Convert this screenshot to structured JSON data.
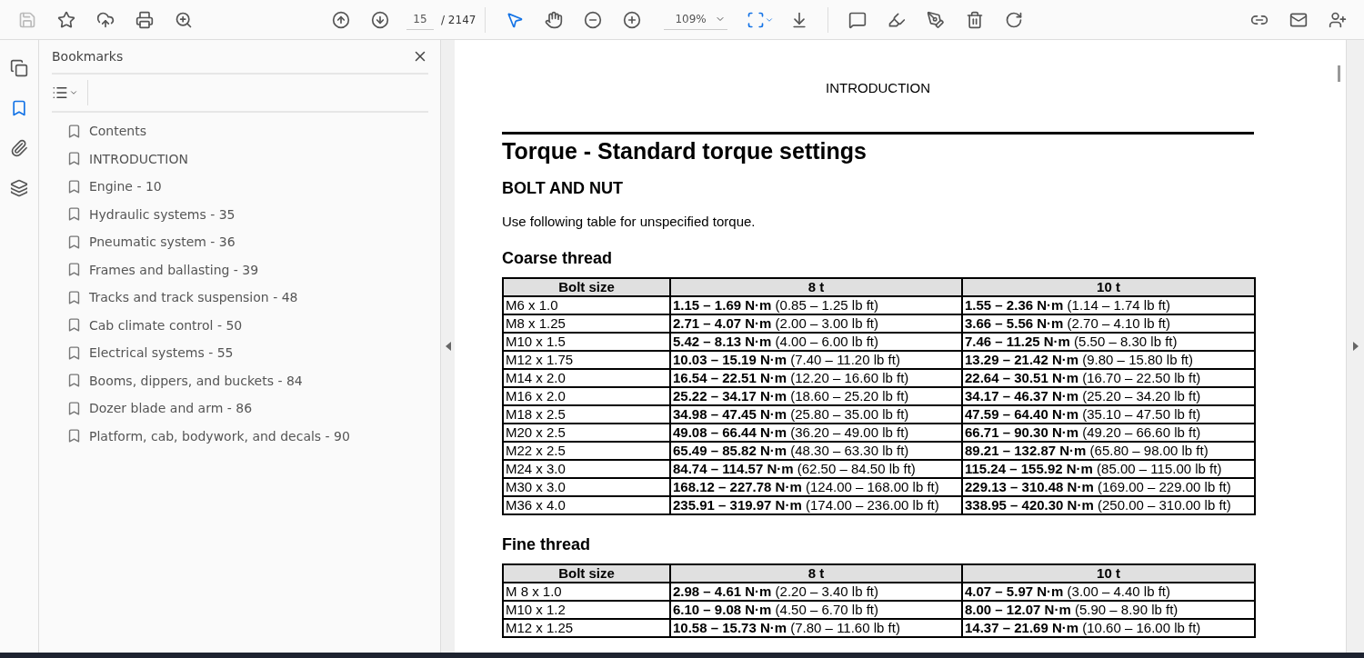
{
  "toolbar": {
    "save_disabled": true,
    "page_number": "15",
    "page_total": "/ 2147",
    "zoom": "109%",
    "tools": [
      {
        "selected": true
      },
      {
        "selected": false
      }
    ]
  },
  "rail": [
    {
      "selected": false
    },
    {
      "selected": true
    },
    {
      "selected": false
    },
    {
      "selected": false
    }
  ],
  "bookmarks": {
    "title": "Bookmarks",
    "items": [
      {
        "label": "Contents"
      },
      {
        "label": "INTRODUCTION"
      },
      {
        "label": "Engine - 10"
      },
      {
        "label": "Hydraulic systems - 35"
      },
      {
        "label": "Pneumatic system - 36"
      },
      {
        "label": "Frames and ballasting - 39"
      },
      {
        "label": "Tracks and track suspension - 48"
      },
      {
        "label": "Cab climate control - 50"
      },
      {
        "label": "Electrical systems - 55"
      },
      {
        "label": "Booms, dippers, and buckets - 84"
      },
      {
        "label": "Dozer blade and arm - 86"
      },
      {
        "label": "Platform, cab, bodywork, and decals - 90"
      }
    ]
  },
  "document": {
    "running_header": "INTRODUCTION",
    "title": "Torque - Standard torque settings",
    "subtitle": "BOLT AND NUT",
    "intro": "Use following table for unspecified torque.",
    "sections": [
      {
        "heading": "Coarse thread",
        "columns": [
          "Bolt size",
          "8 t",
          "10 t"
        ],
        "rows": [
          [
            "M6 x 1.0",
            "**1.15 – 1.69 N·m** (0.85 – 1.25 lb ft)",
            "**1.55 – 2.36 N·m** (1.14 – 1.74 lb ft)"
          ],
          [
            "M8 x 1.25",
            "**2.71 – 4.07 N·m** (2.00 – 3.00 lb ft)",
            "**3.66 – 5.56 N·m** (2.70 – 4.10 lb ft)"
          ],
          [
            "M10 x 1.5",
            "**5.42 – 8.13 N·m** (4.00 – 6.00 lb ft)",
            "**7.46 – 11.25 N·m** (5.50 – 8.30 lb ft)"
          ],
          [
            "M12 x 1.75",
            "**10.03 – 15.19 N·m** (7.40 – 11.20 lb ft)",
            "**13.29 – 21.42 N·m** (9.80 – 15.80 lb ft)"
          ],
          [
            "M14 x 2.0",
            "**16.54 – 22.51 N·m** (12.20 – 16.60 lb ft)",
            "**22.64 – 30.51 N·m** (16.70 – 22.50 lb ft)"
          ],
          [
            "M16 x 2.0",
            "**25.22 – 34.17 N·m** (18.60 – 25.20 lb ft)",
            "**34.17 – 46.37 N·m** (25.20 – 34.20 lb ft)"
          ],
          [
            "M18 x 2.5",
            "**34.98 – 47.45 N·m** (25.80 – 35.00 lb ft)",
            "**47.59 – 64.40 N·m** (35.10 – 47.50 lb ft)"
          ],
          [
            "M20 x 2.5",
            "**49.08 – 66.44 N·m** (36.20 – 49.00 lb ft)",
            "**66.71 – 90.30 N·m** (49.20 – 66.60 lb ft)"
          ],
          [
            "M22 x 2.5",
            "**65.49 – 85.82 N·m** (48.30 – 63.30 lb ft)",
            "**89.21 – 132.87 N·m** (65.80 – 98.00 lb ft)"
          ],
          [
            "M24 x 3.0",
            "**84.74 – 114.57 N·m** (62.50 – 84.50 lb ft)",
            "**115.24 – 155.92 N·m** (85.00 – 115.00 lb ft)"
          ],
          [
            "M30 x 3.0",
            "**168.12 – 227.78 N·m** (124.00 – 168.00 lb ft)",
            "**229.13 – 310.48 N·m** (169.00 – 229.00 lb ft)"
          ],
          [
            "M36 x 4.0",
            "**235.91 – 319.97 N·m** (174.00 – 236.00 lb ft)",
            "**338.95 – 420.30 N·m** (250.00 – 310.00 lb ft)"
          ]
        ]
      },
      {
        "heading": "Fine thread",
        "columns": [
          "Bolt size",
          "8 t",
          "10 t"
        ],
        "rows": [
          [
            "M 8 x 1.0",
            "**2.98 – 4.61 N·m** (2.20 – 3.40 lb ft)",
            "**4.07 – 5.97 N·m** (3.00 – 4.40 lb ft)"
          ],
          [
            "M10 x 1.2",
            "**6.10 – 9.08 N·m** (4.50 – 6.70 lb ft)",
            "**8.00 – 12.07 N·m** (5.90 – 8.90 lb ft)"
          ],
          [
            "M12 x 1.25",
            "**10.58 – 15.73 N·m** (7.80 – 11.60 lb ft)",
            "**14.37 – 21.69 N·m** (10.60 – 16.00 lb ft)"
          ]
        ]
      }
    ]
  }
}
